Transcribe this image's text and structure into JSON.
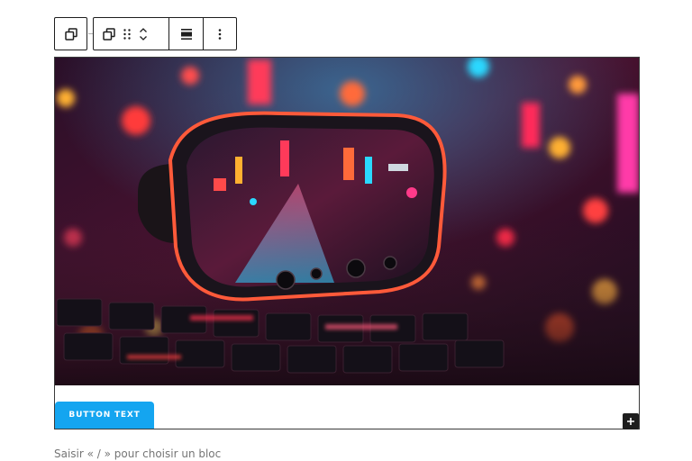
{
  "toolbar": {
    "parent_icon": "copy-icon",
    "transform_icon": "copy-icon",
    "drag_icon": "drag-handle-icon",
    "move_up_icon": "chevron-up-icon",
    "move_down_icon": "chevron-down-icon",
    "align_icon": "align-full-width-icon",
    "options_icon": "more-vertical-icon"
  },
  "block": {
    "image_icon": "vr-headset-neon-city-image",
    "button_text": "BUTTON TEXT",
    "button_color": "#14a5f0",
    "inserter_icon": "plus-icon"
  },
  "editor": {
    "placeholder": "Saisir « / » pour choisir un bloc"
  }
}
